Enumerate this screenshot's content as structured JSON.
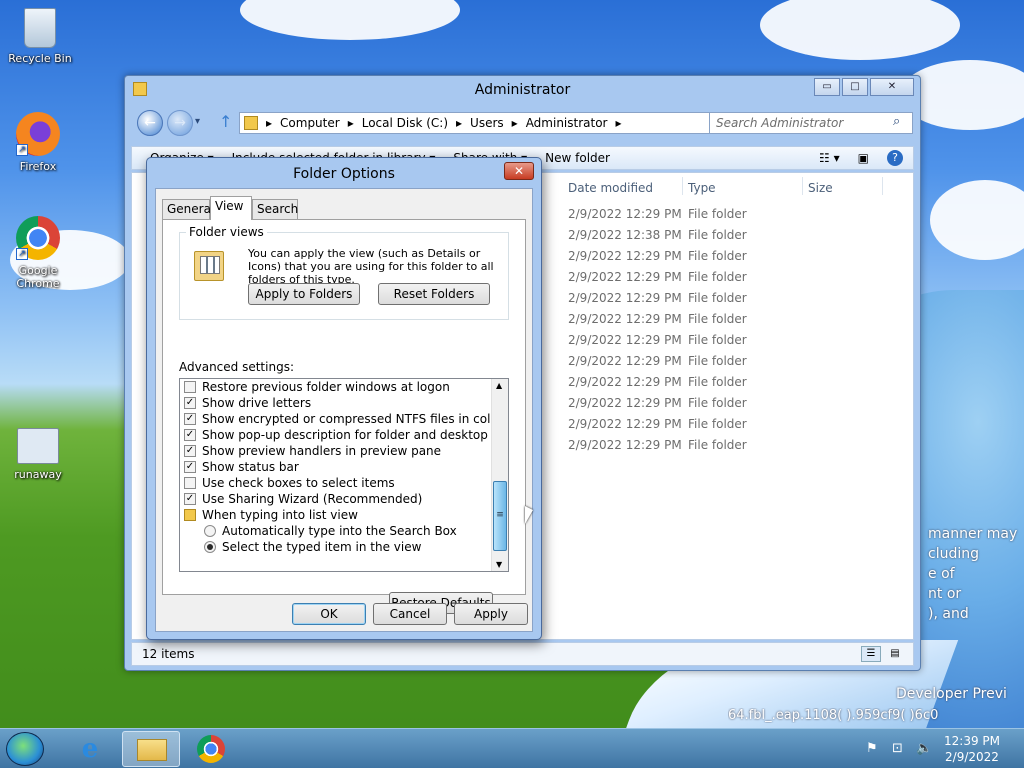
{
  "desktop": {
    "icons": [
      {
        "name": "recycle-bin-icon",
        "label": "Recycle Bin"
      },
      {
        "name": "firefox-icon",
        "label": "Firefox"
      },
      {
        "name": "chrome-icon",
        "label": "Google Chrome"
      },
      {
        "name": "runaway-icon",
        "label": "runaway"
      }
    ],
    "watermark_lines": [
      "manner may",
      "cluding",
      "e of",
      "nt or",
      "), and"
    ],
    "build_text": "Developer Previ",
    "build_line": "64.fbl_.eap.1108(    ).959cf9(    )6c0"
  },
  "explorer": {
    "title": "Administrator",
    "window_buttons": [
      "▭",
      "□",
      "✕"
    ],
    "breadcrumb": [
      "Computer",
      "Local Disk (C:)",
      "Users",
      "Administrator"
    ],
    "search_placeholder": "Search Administrator",
    "toolbar": {
      "organize": "Organize ▾",
      "include": "Include selected folder in library ▾",
      "share": "Share with ▾",
      "new_folder": "New folder"
    },
    "columns": {
      "date": "Date modified",
      "type": "Type",
      "size": "Size"
    },
    "rows": [
      {
        "date": "2/9/2022 12:29 PM",
        "type": "File folder"
      },
      {
        "date": "2/9/2022 12:38 PM",
        "type": "File folder"
      },
      {
        "date": "2/9/2022 12:29 PM",
        "type": "File folder"
      },
      {
        "date": "2/9/2022 12:29 PM",
        "type": "File folder"
      },
      {
        "date": "2/9/2022 12:29 PM",
        "type": "File folder"
      },
      {
        "date": "2/9/2022 12:29 PM",
        "type": "File folder"
      },
      {
        "date": "2/9/2022 12:29 PM",
        "type": "File folder"
      },
      {
        "date": "2/9/2022 12:29 PM",
        "type": "File folder"
      },
      {
        "date": "2/9/2022 12:29 PM",
        "type": "File folder"
      },
      {
        "date": "2/9/2022 12:29 PM",
        "type": "File folder"
      },
      {
        "date": "2/9/2022 12:29 PM",
        "type": "File folder"
      },
      {
        "date": "2/9/2022 12:29 PM",
        "type": "File folder"
      }
    ],
    "status": "12 items"
  },
  "dialog": {
    "title": "Folder Options",
    "close": "✕",
    "tabs": [
      "General",
      "View",
      "Search"
    ],
    "folder_views": {
      "label": "Folder views",
      "description": "You can apply the view (such as Details or Icons) that you are using for this folder to all folders of this type.",
      "apply_to_folders": "Apply to Folders",
      "reset_folders": "Reset Folders"
    },
    "advanced_label": "Advanced settings:",
    "settings": [
      {
        "kind": "checkbox",
        "checked": false,
        "label": "Restore previous folder windows at logon"
      },
      {
        "kind": "checkbox",
        "checked": true,
        "label": "Show drive letters"
      },
      {
        "kind": "checkbox",
        "checked": true,
        "label": "Show encrypted or compressed NTFS files in color"
      },
      {
        "kind": "checkbox",
        "checked": true,
        "label": "Show pop-up description for folder and desktop items"
      },
      {
        "kind": "checkbox",
        "checked": true,
        "label": "Show preview handlers in preview pane"
      },
      {
        "kind": "checkbox",
        "checked": true,
        "label": "Show status bar"
      },
      {
        "kind": "checkbox",
        "checked": false,
        "label": "Use check boxes to select items"
      },
      {
        "kind": "checkbox",
        "checked": true,
        "label": "Use Sharing Wizard (Recommended)"
      },
      {
        "kind": "folder",
        "label": "When typing into list view"
      },
      {
        "kind": "radio",
        "checked": false,
        "label": "Automatically type into the Search Box"
      },
      {
        "kind": "radio",
        "checked": true,
        "label": "Select the typed item in the view"
      }
    ],
    "restore_defaults": "Restore Defaults",
    "ok": "OK",
    "cancel": "Cancel",
    "apply": "Apply"
  },
  "taskbar": {
    "time": "12:39 PM",
    "date": "2/9/2022"
  }
}
